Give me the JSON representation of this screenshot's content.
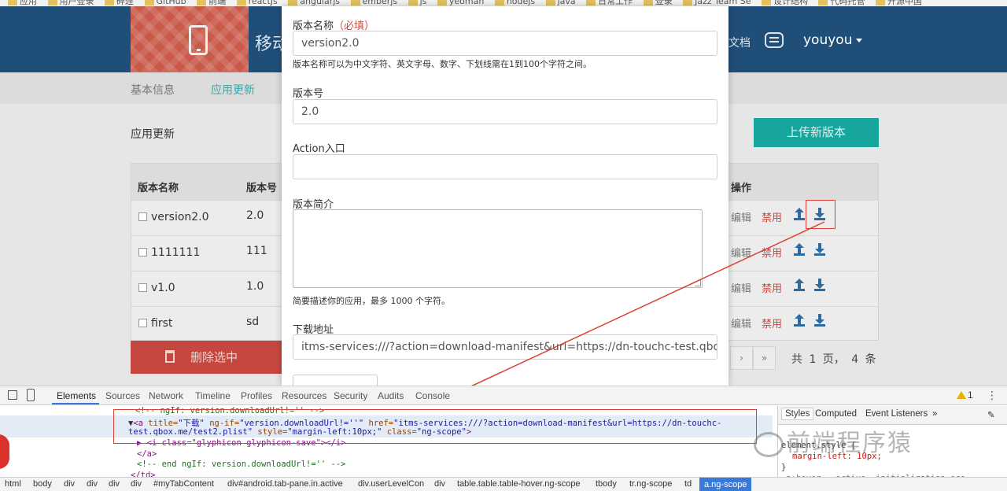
{
  "bookmarks": [
    "应用",
    "用户登录",
    "碎连",
    "GitHub",
    "前端",
    "reactJs",
    "angularjs",
    "emberjs",
    "js",
    "yeoman",
    "nodejs",
    "java",
    "日常工作",
    "登录",
    "Jazz Team Se",
    "设计结构",
    "代码托管",
    "开源中国"
  ],
  "header": {
    "title": "移动",
    "doc_link": "文档",
    "user": "youyou"
  },
  "subnav": {
    "tabs": [
      "基本信息",
      "应用更新"
    ]
  },
  "main": {
    "section_title": "应用更新",
    "upload_button": "上传新版本",
    "table": {
      "headers": {
        "name": "版本名称",
        "version": "版本号",
        "actions": "操作"
      },
      "rows": [
        {
          "name": "version2.0",
          "version": "2.0"
        },
        {
          "name": "1111111",
          "version": "111"
        },
        {
          "name": "v1.0",
          "version": "1.0"
        },
        {
          "name": "first",
          "version": "sd"
        }
      ],
      "edit_label": "编辑",
      "ban_label": "禁用"
    },
    "delete_button": "删除选中",
    "pager": {
      "next": "›",
      "last": "»",
      "info": "共 1 页， 4 条"
    }
  },
  "modal": {
    "name_label": "版本名称",
    "required_hint": "（必填）",
    "name_value": "version2.0",
    "name_help": "版本名称可以为中文字符、英文字母、数字、下划线需在1到100个字符之间。",
    "version_label": "版本号",
    "version_value": "2.0",
    "action_label": "Action入口",
    "action_value": "",
    "desc_label": "版本简介",
    "desc_help": "简要描述你的应用，最多 1000 个字符。",
    "download_label": "下载地址",
    "download_value": "itms-services:///?action=download-manifest&url=https://dn-touchc-test.qbox.me"
  },
  "devtools": {
    "tabs": [
      "Elements",
      "Sources",
      "Network",
      "Timeline",
      "Profiles",
      "Resources",
      "Security",
      "Audits",
      "Console"
    ],
    "warning_count": "1",
    "code": {
      "line1": "<!-- ngIf: version.downloadUrl!='' -->",
      "line2_a": "<a ",
      "line2_title_attr": "title=",
      "line2_title_val": "\"下载\"",
      "line2_ngif_attr": " ng-if=",
      "line2_ngif_val": "\"version.downloadUrl!=''\"",
      "line2_href_attr": " href=",
      "line2_href_val": "\"itms-services:///?action=download-manifest&url=https://dn-touchc-",
      "line3_href_cont": "test.qbox.me/test2.plist\"",
      "line3_style_attr": " style=",
      "line3_style_val": "\"margin-left:10px;\"",
      "line3_class_attr": " class=",
      "line3_class_val": "\"ng-scope\"",
      "line3_end": ">",
      "line4": "<i class=\"glyphicon glyphicon-save\"></i>",
      "line5": "</a>",
      "line6": "<!-- end ngIf: version.downloadUrl!='' -->",
      "line7": "</td>"
    },
    "side_tabs": [
      "Styles",
      "Computed",
      "Event Listeners"
    ],
    "side_code": {
      "line1": "element.style {",
      "line2": "margin-left: 10px;",
      "line3": "}",
      "line4": ".a:hover, .active .initialization sco"
    },
    "breadcrumbs": [
      "html",
      "body",
      "div",
      "div",
      "div",
      "div",
      "#myTabContent",
      "div#android.tab-pane.in.active",
      "div.userLevelCon",
      "div",
      "table.table.table-hover.ng-scope",
      "tbody",
      "tr.ng-scope",
      "td",
      "a.ng-scope"
    ]
  },
  "watermark": "前端程序猿",
  "colors": {
    "header_bg": "#1f4e79",
    "accent_teal": "#17a69d",
    "danger_red": "#c6473f",
    "annotation_red": "#d94235"
  }
}
